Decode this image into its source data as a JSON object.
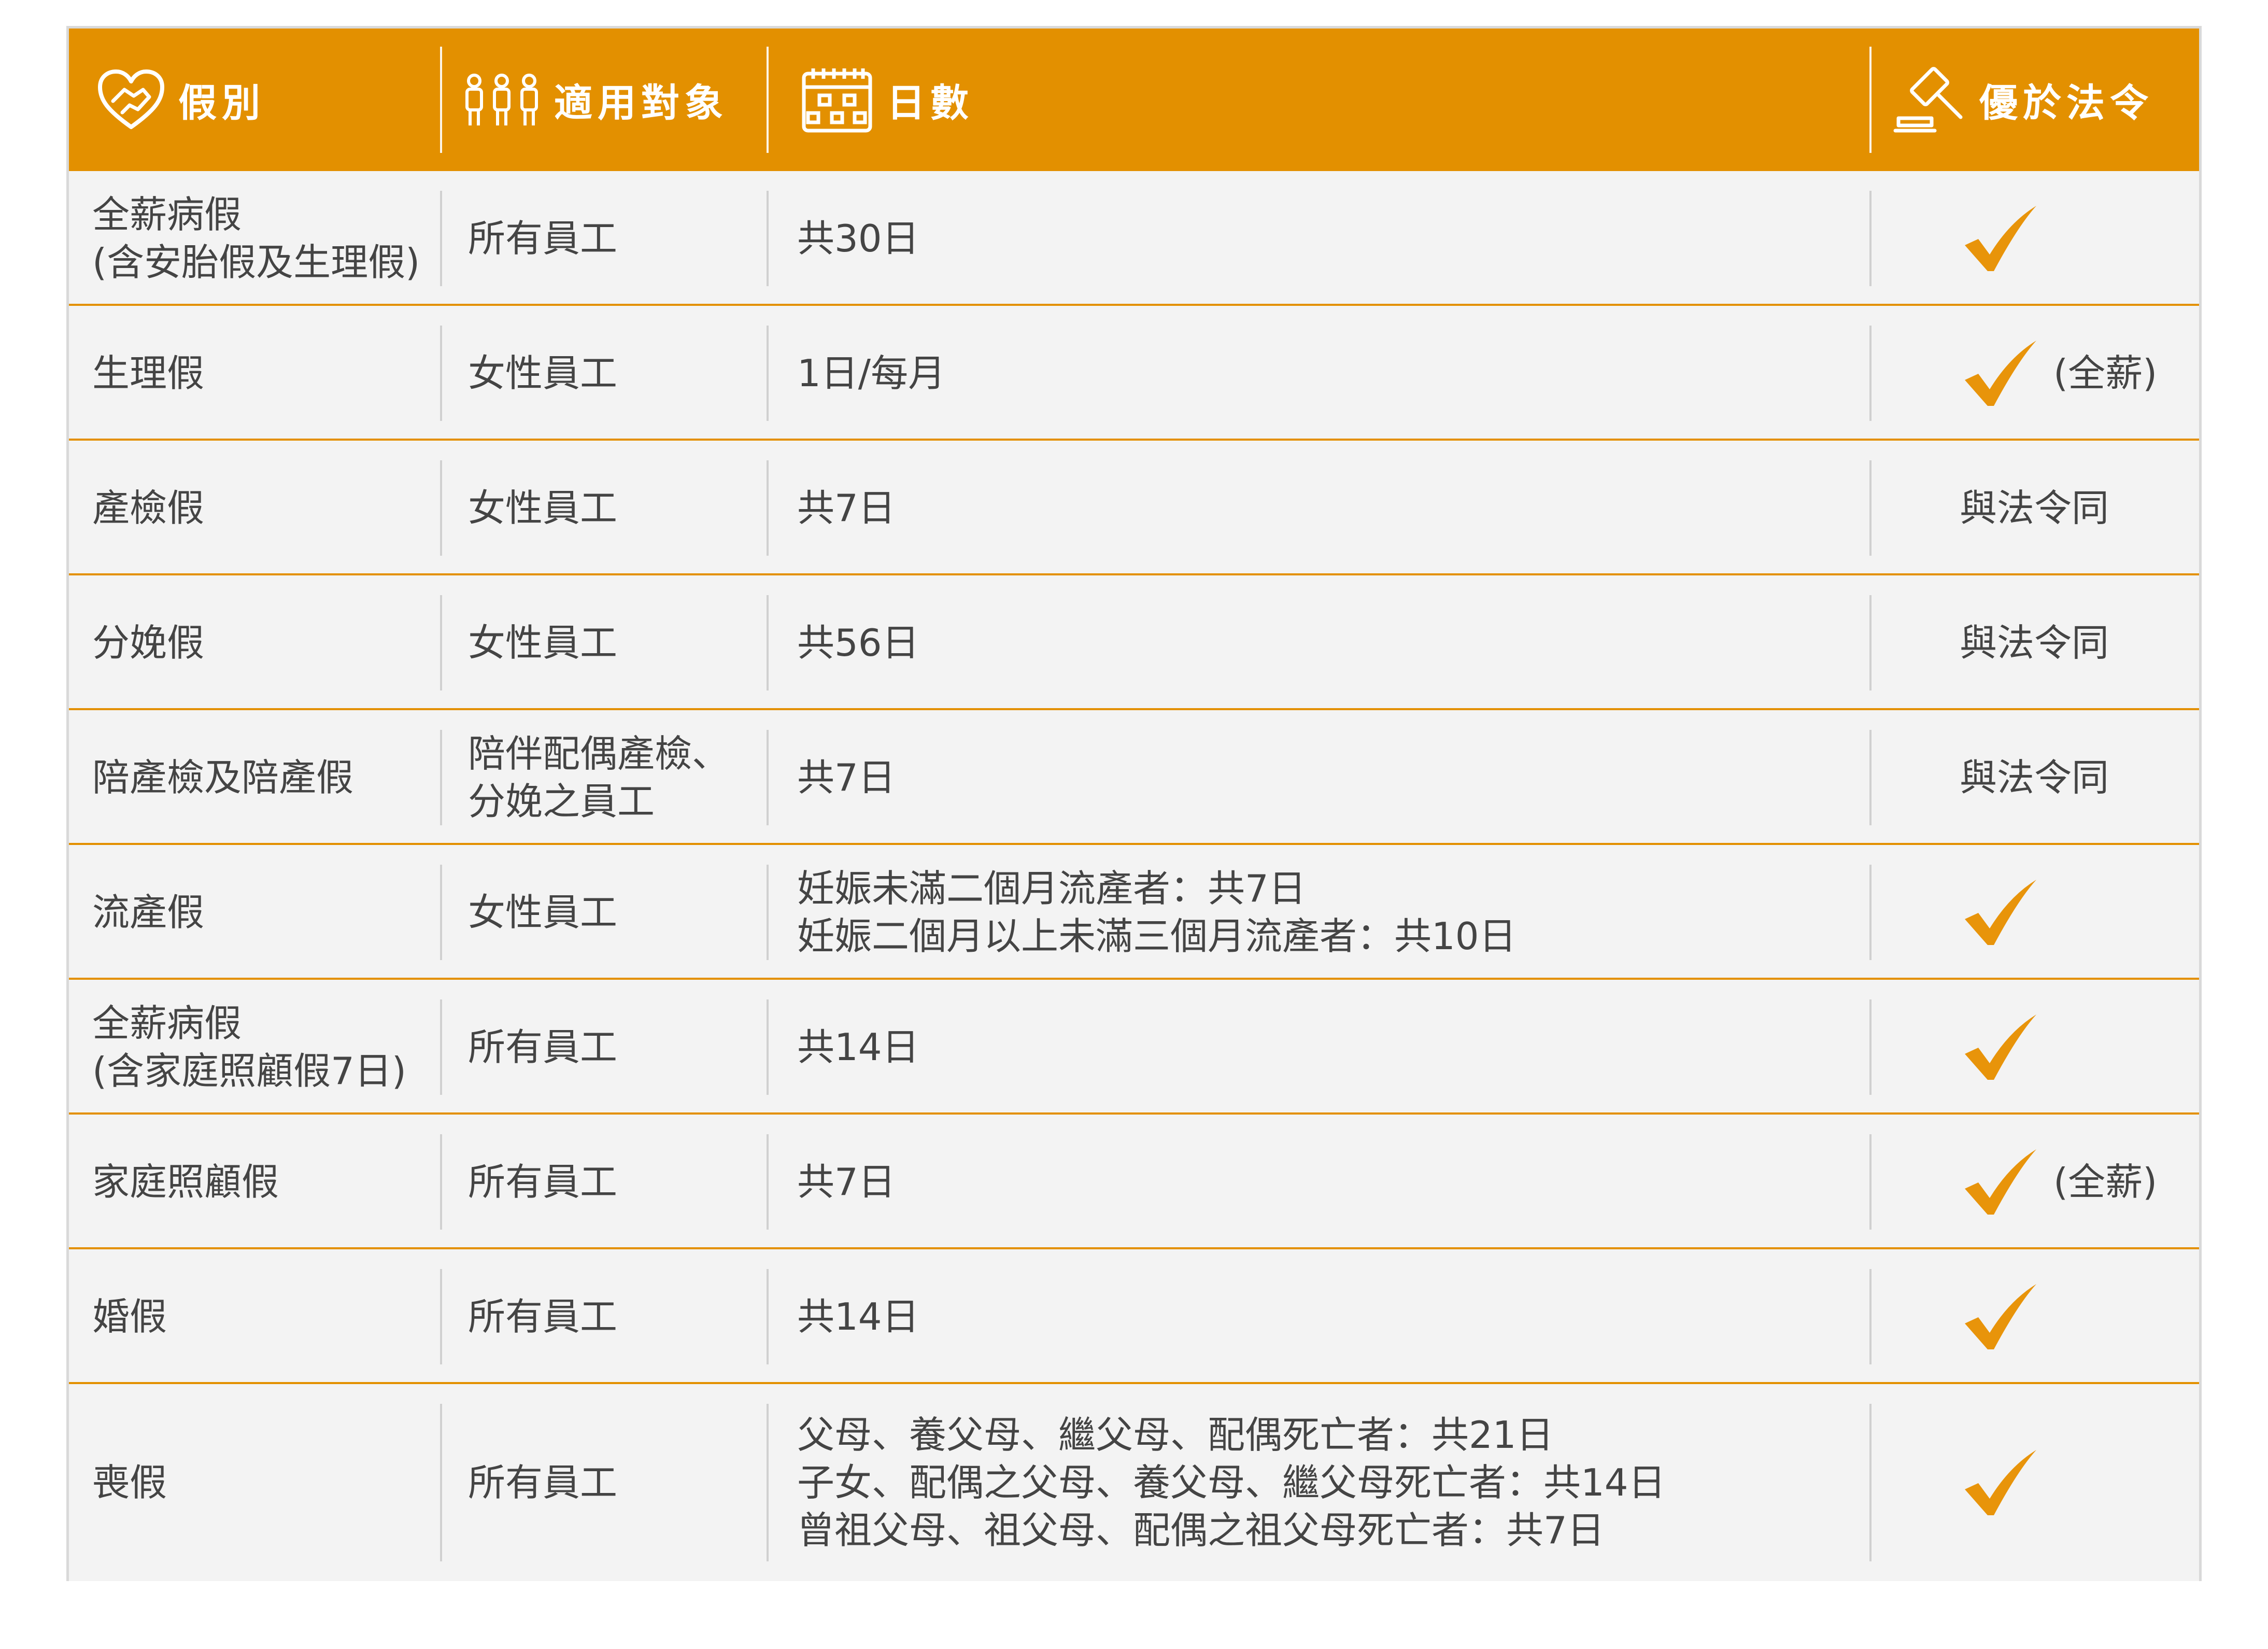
{
  "header": {
    "type_label": "假別",
    "target_label": "適用對象",
    "days_label": "日數",
    "priv_label": "優於法令",
    "type_icon": "heart-handshake-icon",
    "target_icon": "people-group-icon",
    "days_icon": "calendar-icon",
    "priv_icon": "gavel-icon"
  },
  "colors": {
    "accent": "#e39000",
    "row_bg": "#f3f3f3",
    "text": "#444444",
    "check": "#e8940a"
  },
  "rows": [
    {
      "type": [
        "全薪病假",
        "(含安胎假及生理假)"
      ],
      "target": [
        "所有員工"
      ],
      "days": [
        "共30日"
      ],
      "priv": "check",
      "note": ""
    },
    {
      "type": [
        "生理假"
      ],
      "target": [
        "女性員工"
      ],
      "days": [
        "1日/每月"
      ],
      "priv": "check",
      "note": "(全薪)"
    },
    {
      "type": [
        "產檢假"
      ],
      "target": [
        "女性員工"
      ],
      "days": [
        "共7日"
      ],
      "priv": "text",
      "text": "與法令同"
    },
    {
      "type": [
        "分娩假"
      ],
      "target": [
        "女性員工"
      ],
      "days": [
        "共56日"
      ],
      "priv": "text",
      "text": "與法令同"
    },
    {
      "type": [
        "陪產檢及陪產假"
      ],
      "target": [
        "陪伴配偶產檢、",
        "分娩之員工"
      ],
      "days": [
        "共7日"
      ],
      "priv": "text",
      "text": "與法令同"
    },
    {
      "type": [
        "流產假"
      ],
      "target": [
        "女性員工"
      ],
      "days": [
        "妊娠未滿二個月流產者：共7日",
        "妊娠二個月以上未滿三個月流產者：共10日"
      ],
      "priv": "check",
      "note": ""
    },
    {
      "type": [
        "全薪病假",
        "(含家庭照顧假7日)"
      ],
      "target": [
        "所有員工"
      ],
      "days": [
        "共14日"
      ],
      "priv": "check",
      "note": ""
    },
    {
      "type": [
        "家庭照顧假"
      ],
      "target": [
        "所有員工"
      ],
      "days": [
        "共7日"
      ],
      "priv": "check",
      "note": "(全薪)"
    },
    {
      "type": [
        "婚假"
      ],
      "target": [
        "所有員工"
      ],
      "days": [
        "共14日"
      ],
      "priv": "check",
      "note": ""
    },
    {
      "type": [
        "喪假"
      ],
      "target": [
        "所有員工"
      ],
      "days": [
        "父母、養父母、繼父母、配偶死亡者：共21日",
        "子女、配偶之父母、養父母、繼父母死亡者：共14日",
        "曾祖父母、祖父母、配偶之祖父母死亡者：共7日"
      ],
      "priv": "check",
      "note": ""
    }
  ]
}
